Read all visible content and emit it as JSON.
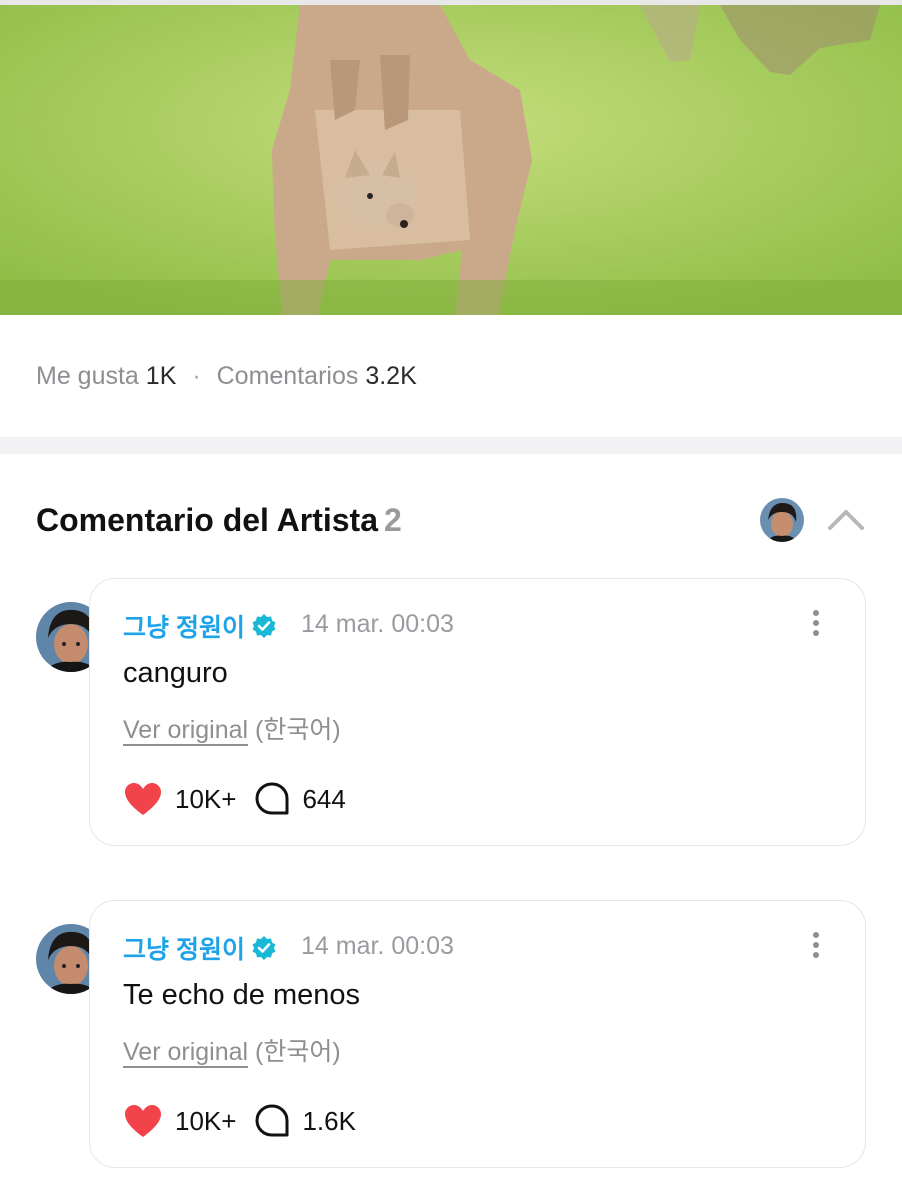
{
  "post": {
    "image_alt": "kangaroo-photo",
    "stats": {
      "likes_label": "Me gusta",
      "likes_value": "1K",
      "separator": "·",
      "comments_label": "Comentarios",
      "comments_value": "3.2K"
    }
  },
  "artist_section": {
    "title": "Comentario del Artista",
    "count": "2",
    "collapse_icon": "chevron-up-icon"
  },
  "comments": [
    {
      "author": "그냥 정원이",
      "time": "14 mar. 00:03",
      "text": "canguro",
      "see_original": "Ver original",
      "language": "(한국어)",
      "likes": "10K+",
      "replies": "644"
    },
    {
      "author": "그냥 정원이",
      "time": "14 mar. 00:03",
      "text": "Te echo de menos",
      "see_original": "Ver original",
      "language": "(한국어)",
      "likes": "10K+",
      "replies": "1.6K"
    }
  ],
  "colors": {
    "author": "#1fa3e8",
    "verified_badge": "#19b8d6",
    "heart": "#f2434b",
    "muted": "#8e8e93"
  }
}
